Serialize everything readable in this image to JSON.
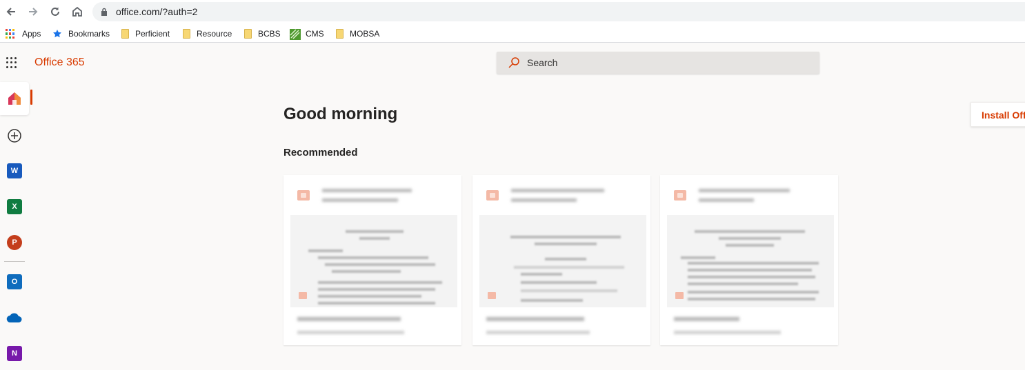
{
  "browser": {
    "url": "office.com/?auth=2",
    "bookmarks": [
      {
        "label": "Apps",
        "icon": "apps-grid-icon"
      },
      {
        "label": "Bookmarks",
        "icon": "star-icon"
      },
      {
        "label": "Perficient",
        "icon": "folder-icon"
      },
      {
        "label": "Resource",
        "icon": "folder-icon"
      },
      {
        "label": "BCBS",
        "icon": "folder-icon"
      },
      {
        "label": "CMS",
        "icon": "cms-icon"
      },
      {
        "label": "MOBSA",
        "icon": "folder-icon"
      }
    ]
  },
  "header": {
    "brand": "Office 365",
    "search_placeholder": "Search"
  },
  "rail": {
    "items": [
      {
        "name": "home",
        "icon": "home-icon",
        "active": true
      },
      {
        "name": "create",
        "icon": "add-circle-icon"
      },
      {
        "name": "word",
        "icon": "word-icon",
        "letter": "W",
        "color": "#185abd"
      },
      {
        "name": "excel",
        "icon": "excel-icon",
        "letter": "X",
        "color": "#107c41"
      },
      {
        "name": "powerpoint",
        "icon": "powerpoint-icon",
        "letter": "P",
        "color": "#c43e1c"
      },
      {
        "name": "outlook",
        "icon": "outlook-icon",
        "letter": "O",
        "color": "#0f6cbd"
      },
      {
        "name": "onedrive",
        "icon": "onedrive-icon",
        "color": "#0364b8"
      },
      {
        "name": "onenote",
        "icon": "onenote-icon",
        "letter": "N",
        "color": "#7719aa"
      }
    ]
  },
  "main": {
    "greeting": "Good morning",
    "install_label": "Install Office",
    "recommended_title": "Recommended"
  },
  "colors": {
    "accent": "#d83b01",
    "background": "#faf9f8"
  }
}
